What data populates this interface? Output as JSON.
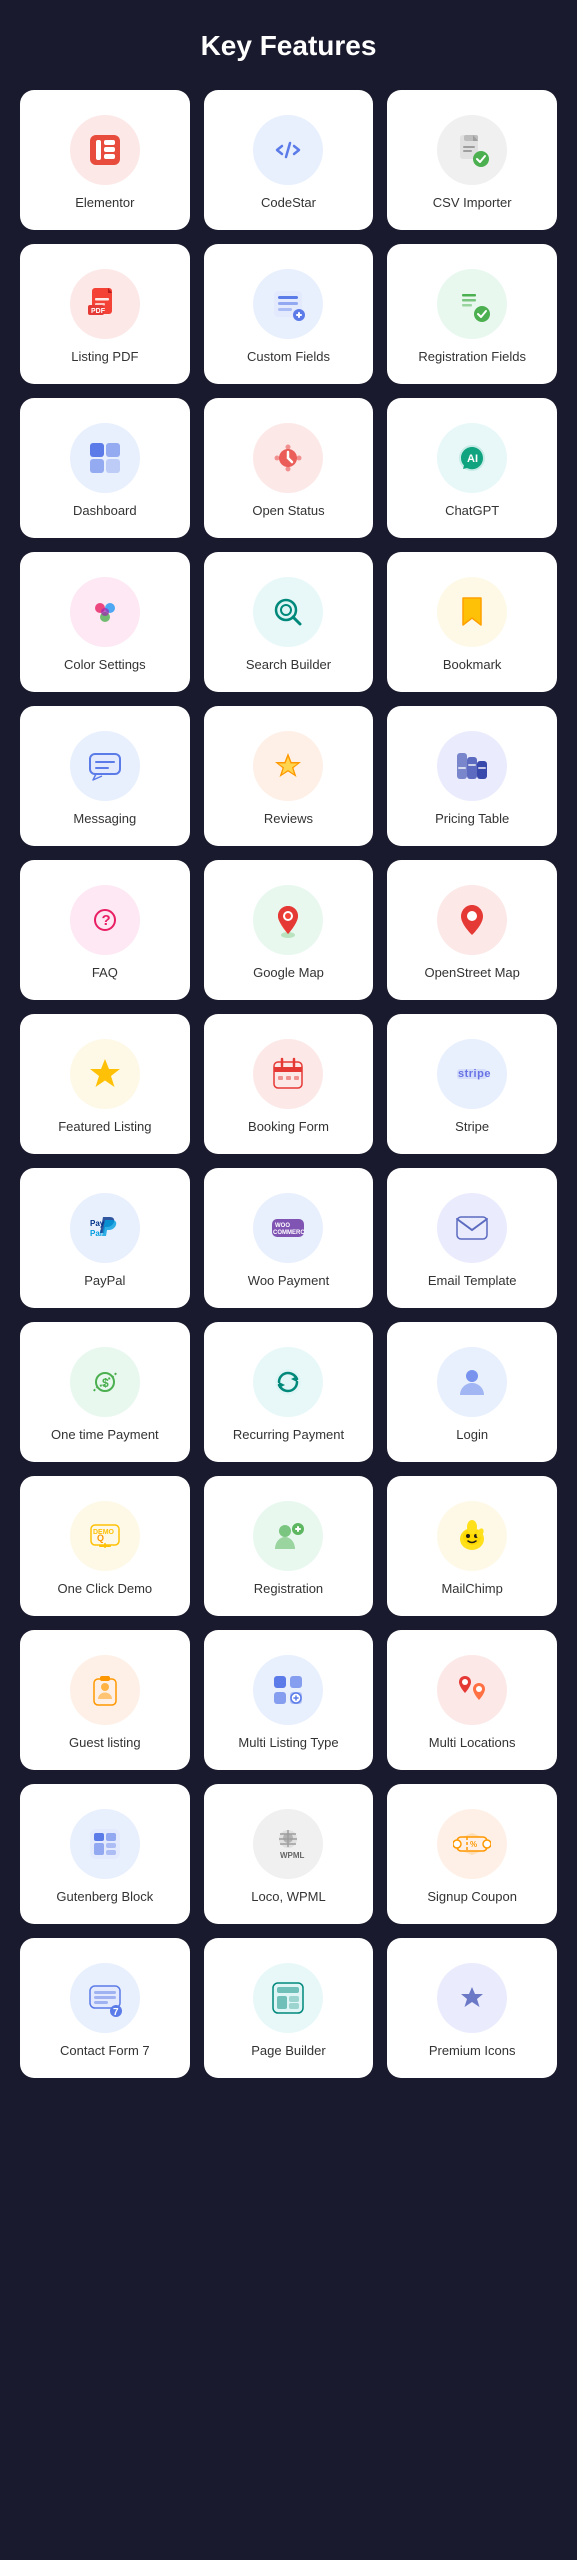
{
  "page": {
    "title": "Key Features",
    "background": "#1a1a2e"
  },
  "features": [
    {
      "id": "elementor",
      "label": "Elementor",
      "icon": "elementor",
      "bg": "bg-red"
    },
    {
      "id": "codestar",
      "label": "CodeStar",
      "icon": "codestar",
      "bg": "bg-blue"
    },
    {
      "id": "csv-importer",
      "label": "CSV Importer",
      "icon": "csv",
      "bg": "bg-gray"
    },
    {
      "id": "listing-pdf",
      "label": "Listing PDF",
      "icon": "pdf",
      "bg": "bg-red"
    },
    {
      "id": "custom-fields",
      "label": "Custom Fields",
      "icon": "fields",
      "bg": "bg-blue"
    },
    {
      "id": "registration-fields",
      "label": "Registration Fields",
      "icon": "regfields",
      "bg": "bg-green"
    },
    {
      "id": "dashboard",
      "label": "Dashboard",
      "icon": "dashboard",
      "bg": "bg-blue"
    },
    {
      "id": "open-status",
      "label": "Open Status",
      "icon": "openstatus",
      "bg": "bg-red"
    },
    {
      "id": "chatgpt",
      "label": "ChatGPT",
      "icon": "chatgpt",
      "bg": "bg-teal"
    },
    {
      "id": "color-settings",
      "label": "Color Settings",
      "icon": "color",
      "bg": "bg-pink"
    },
    {
      "id": "search-builder",
      "label": "Search Builder",
      "icon": "search",
      "bg": "bg-teal"
    },
    {
      "id": "bookmark",
      "label": "Bookmark",
      "icon": "bookmark",
      "bg": "bg-yellow"
    },
    {
      "id": "messaging",
      "label": "Messaging",
      "icon": "messaging",
      "bg": "bg-blue"
    },
    {
      "id": "reviews",
      "label": "Reviews",
      "icon": "reviews",
      "bg": "bg-orange"
    },
    {
      "id": "pricing-table",
      "label": "Pricing Table",
      "icon": "pricing",
      "bg": "bg-indigo"
    },
    {
      "id": "faq",
      "label": "FAQ",
      "icon": "faq",
      "bg": "bg-pink"
    },
    {
      "id": "google-map",
      "label": "Google Map",
      "icon": "googlemap",
      "bg": "bg-green"
    },
    {
      "id": "openstreet-map",
      "label": "OpenStreet Map",
      "icon": "openstreet",
      "bg": "bg-red"
    },
    {
      "id": "featured-listing",
      "label": "Featured Listing",
      "icon": "featured",
      "bg": "bg-yellow"
    },
    {
      "id": "booking-form",
      "label": "Booking Form",
      "icon": "booking",
      "bg": "bg-red"
    },
    {
      "id": "stripe",
      "label": "Stripe",
      "icon": "stripe",
      "bg": "bg-blue"
    },
    {
      "id": "paypal",
      "label": "PayPal",
      "icon": "paypal",
      "bg": "bg-blue"
    },
    {
      "id": "woo-payment",
      "label": "Woo Payment",
      "icon": "woo",
      "bg": "bg-blue"
    },
    {
      "id": "email-template",
      "label": "Email Template",
      "icon": "email",
      "bg": "bg-indigo"
    },
    {
      "id": "one-time-payment",
      "label": "One time Payment",
      "icon": "onetime",
      "bg": "bg-green"
    },
    {
      "id": "recurring-payment",
      "label": "Recurring Payment",
      "icon": "recurring",
      "bg": "bg-teal"
    },
    {
      "id": "login",
      "label": "Login",
      "icon": "login",
      "bg": "bg-blue"
    },
    {
      "id": "one-click-demo",
      "label": "One Click Demo",
      "icon": "demo",
      "bg": "bg-yellow"
    },
    {
      "id": "registration",
      "label": "Registration",
      "icon": "registration",
      "bg": "bg-green"
    },
    {
      "id": "mailchimp",
      "label": "MailChimp",
      "icon": "mailchimp",
      "bg": "bg-yellow"
    },
    {
      "id": "guest-listing",
      "label": "Guest listing",
      "icon": "guest",
      "bg": "bg-orange"
    },
    {
      "id": "multi-listing",
      "label": "Multi Listing Type",
      "icon": "multilisting",
      "bg": "bg-blue"
    },
    {
      "id": "multi-locations",
      "label": "Multi Locations",
      "icon": "multilocations",
      "bg": "bg-red"
    },
    {
      "id": "gutenberg",
      "label": "Gutenberg Block",
      "icon": "gutenberg",
      "bg": "bg-blue"
    },
    {
      "id": "loco-wpml",
      "label": "Loco, WPML",
      "icon": "wpml",
      "bg": "bg-gray"
    },
    {
      "id": "signup-coupon",
      "label": "Signup Coupon",
      "icon": "coupon",
      "bg": "bg-orange"
    },
    {
      "id": "contact-form7",
      "label": "Contact Form 7",
      "icon": "contactform",
      "bg": "bg-blue"
    },
    {
      "id": "page-builder",
      "label": "Page Builder",
      "icon": "pagebuilder",
      "bg": "bg-teal"
    },
    {
      "id": "premium-icons",
      "label": "Premium Icons",
      "icon": "premiumicons",
      "bg": "bg-indigo"
    }
  ]
}
